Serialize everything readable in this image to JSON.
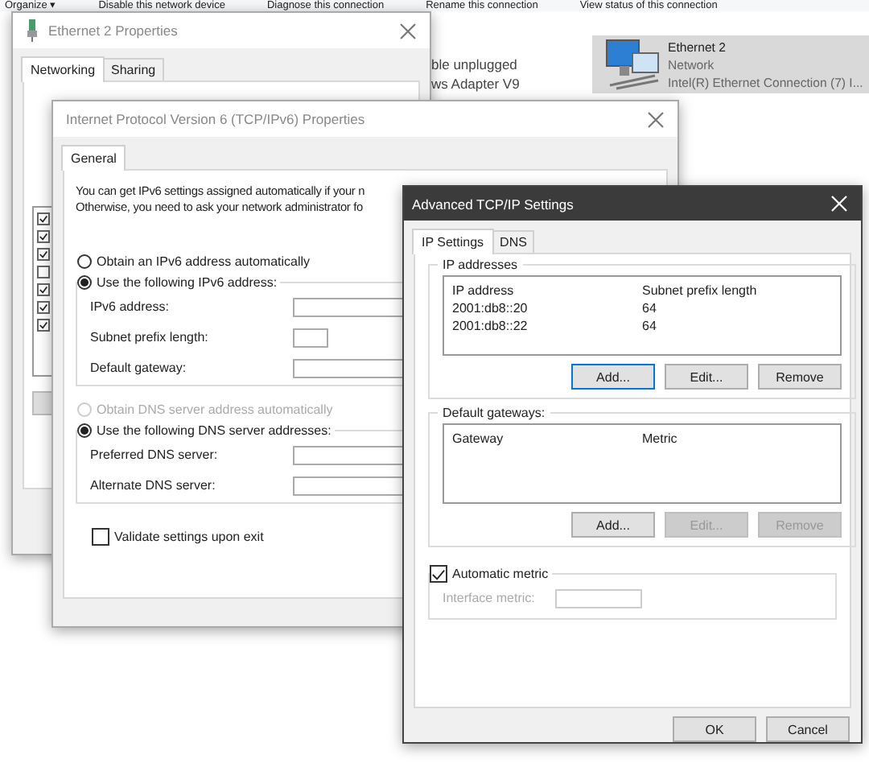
{
  "explorer": {
    "toolbar": [
      "Organize ▾",
      "Disable this network device",
      "Diagnose this connection",
      "Rename this connection",
      "View status of this connection"
    ],
    "status_lines": [
      "ble unplugged",
      "ws Adapter V9"
    ],
    "selected_item": {
      "name": "Ethernet 2",
      "type": "Network",
      "adapter": "Intel(R) Ethernet Connection (7) I...",
      "selected": true
    }
  },
  "ethernet_properties": {
    "title": "Ethernet 2 Properties",
    "tabs": [
      {
        "label": "Networking",
        "selected": true
      },
      {
        "label": "Sharing",
        "selected": false
      }
    ],
    "components": [
      {
        "checked": true
      },
      {
        "checked": true
      },
      {
        "checked": true
      },
      {
        "checked": false
      },
      {
        "checked": true
      },
      {
        "checked": true
      },
      {
        "checked": true
      }
    ]
  },
  "ipv6_properties": {
    "title": "Internet Protocol Version 6 (TCP/IPv6) Properties",
    "tabs": [
      {
        "label": "General",
        "selected": true
      }
    ],
    "intro": [
      "You can get IPv6 settings assigned automatically if your n",
      "Otherwise, you need to ask your network administrator fo"
    ],
    "address_options": [
      {
        "label": "Obtain an IPv6 address automatically",
        "selected": false,
        "disabled": false
      },
      {
        "label": "Use the following IPv6 address:",
        "selected": true,
        "disabled": false
      }
    ],
    "address_fields": [
      {
        "label": "IPv6 address:",
        "kind": "wide"
      },
      {
        "label": "Subnet prefix length:",
        "kind": "short"
      },
      {
        "label": "Default gateway:",
        "kind": "wide"
      }
    ],
    "dns_options": [
      {
        "label": "Obtain DNS server address automatically",
        "selected": false,
        "disabled": true
      },
      {
        "label": "Use the following DNS server addresses:",
        "selected": true,
        "disabled": false
      }
    ],
    "dns_fields": [
      {
        "label": "Preferred DNS server:",
        "kind": "wide"
      },
      {
        "label": "Alternate DNS server:",
        "kind": "wide"
      }
    ],
    "validate": {
      "label": "Validate settings upon exit",
      "checked": false
    }
  },
  "advanced_settings": {
    "title": "Advanced TCP/IP Settings",
    "tabs": [
      {
        "label": "IP Settings",
        "selected": true
      },
      {
        "label": "DNS",
        "selected": false
      }
    ],
    "ip_addresses": {
      "title": "IP addresses",
      "columns": [
        "IP address",
        "Subnet prefix length"
      ],
      "rows": [
        [
          "2001:db8::20",
          "64"
        ],
        [
          "2001:db8::22",
          "64"
        ]
      ],
      "buttons": [
        {
          "label": "Add...",
          "disabled": false,
          "focused": true
        },
        {
          "label": "Edit...",
          "disabled": false,
          "focused": false
        },
        {
          "label": "Remove",
          "disabled": false,
          "focused": false
        }
      ]
    },
    "default_gateways": {
      "title": "Default gateways:",
      "columns": [
        "Gateway",
        "Metric"
      ],
      "buttons": [
        {
          "label": "Add...",
          "disabled": false,
          "focused": false
        },
        {
          "label": "Edit...",
          "disabled": true,
          "focused": false
        },
        {
          "label": "Remove",
          "disabled": true,
          "focused": false
        }
      ]
    },
    "automatic_metric": {
      "label": "Automatic metric",
      "checked": true,
      "field_label": "Interface metric:"
    },
    "buttons": [
      {
        "label": "OK",
        "disabled": false,
        "focused": false
      },
      {
        "label": "Cancel",
        "disabled": false,
        "focused": false
      }
    ]
  }
}
